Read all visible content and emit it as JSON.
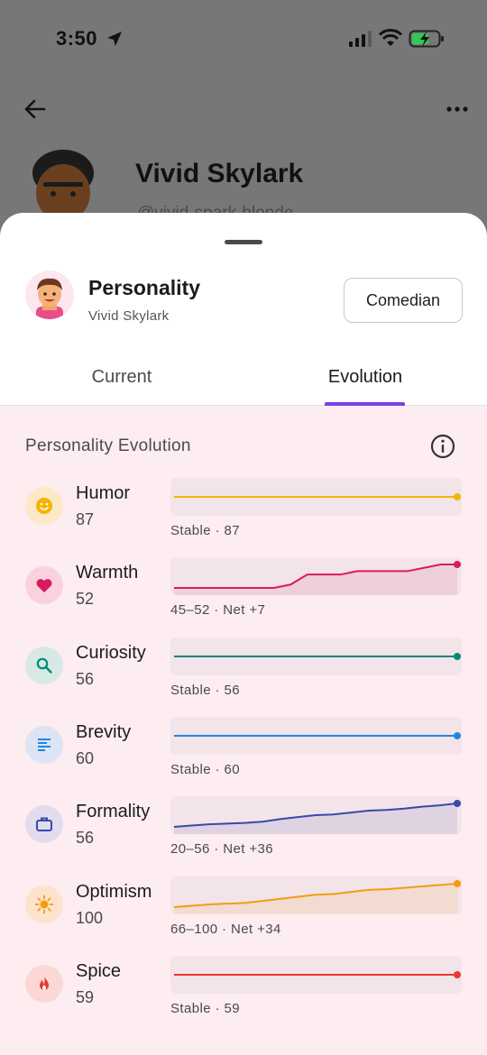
{
  "status_bar": {
    "time": "3:50"
  },
  "profile": {
    "name": "Vivid Skylark",
    "handle": "@vivid-spark-blonde"
  },
  "sheet": {
    "title": "Personality",
    "subtitle": "Vivid Skylark",
    "preset_button_label": "Comedian",
    "tabs": [
      {
        "label": "Current",
        "selected": false
      },
      {
        "label": "Evolution",
        "selected": true
      }
    ],
    "section_title": "Personality Evolution"
  },
  "colors": {
    "accent": "#7b3fe4",
    "humor": "#f4b400",
    "warmth": "#d81b60",
    "curiosity": "#00897b",
    "brevity": "#1e88e5",
    "formality": "#3949ab",
    "optimism": "#f39c12",
    "spice": "#e53935"
  },
  "traits": [
    {
      "name": "Humor",
      "value": "87",
      "caption": "Stable · 87",
      "icon": "smile-icon",
      "color": "#f4b400",
      "icon_bg": "#fde9c8",
      "history": [
        87,
        87,
        87,
        87,
        87,
        87,
        87,
        87,
        87,
        87,
        87,
        87,
        87,
        87,
        87,
        87
      ]
    },
    {
      "name": "Warmth",
      "value": "52",
      "caption": "45–52 · Net +7",
      "icon": "heart-icon",
      "color": "#d81b60",
      "icon_bg": "#f9d2de",
      "history": [
        45,
        45,
        45,
        45,
        45,
        45,
        45,
        46,
        49,
        49,
        49,
        50,
        50,
        50,
        50,
        51,
        52,
        52
      ]
    },
    {
      "name": "Curiosity",
      "value": "56",
      "caption": "Stable · 56",
      "icon": "search-icon",
      "color": "#00897b",
      "icon_bg": "#d6e9e4",
      "history": [
        56,
        56,
        56,
        56,
        56,
        56,
        56,
        56,
        56,
        56,
        56,
        56,
        56,
        56,
        56,
        56
      ]
    },
    {
      "name": "Brevity",
      "value": "60",
      "caption": "Stable · 60",
      "icon": "text-lines-icon",
      "color": "#1e88e5",
      "icon_bg": "#dce4f5",
      "history": [
        60,
        60,
        60,
        60,
        60,
        60,
        60,
        60,
        60,
        60,
        60,
        60,
        60,
        60,
        60,
        60
      ]
    },
    {
      "name": "Formality",
      "value": "56",
      "caption": "20–56 · Net +36",
      "icon": "briefcase-icon",
      "color": "#3949ab",
      "icon_bg": "#e2dcef",
      "history": [
        20,
        22,
        24,
        25,
        26,
        28,
        32,
        35,
        38,
        39,
        42,
        45,
        46,
        48,
        51,
        53,
        56
      ]
    },
    {
      "name": "Optimism",
      "value": "100",
      "caption": "66–100 · Net +34",
      "icon": "sun-icon",
      "color": "#f39c12",
      "icon_bg": "#fde3cc",
      "history": [
        66,
        68,
        70,
        71,
        72,
        75,
        78,
        81,
        84,
        85,
        88,
        91,
        92,
        94,
        96,
        98,
        100
      ]
    },
    {
      "name": "Spice",
      "value": "59",
      "caption": "Stable · 59",
      "icon": "flame-icon",
      "color": "#e53935",
      "icon_bg": "#fbd8d6",
      "history": [
        59,
        59,
        59,
        59,
        59,
        59,
        59,
        59,
        59,
        59,
        59,
        59,
        59,
        59,
        59,
        59
      ]
    }
  ]
}
